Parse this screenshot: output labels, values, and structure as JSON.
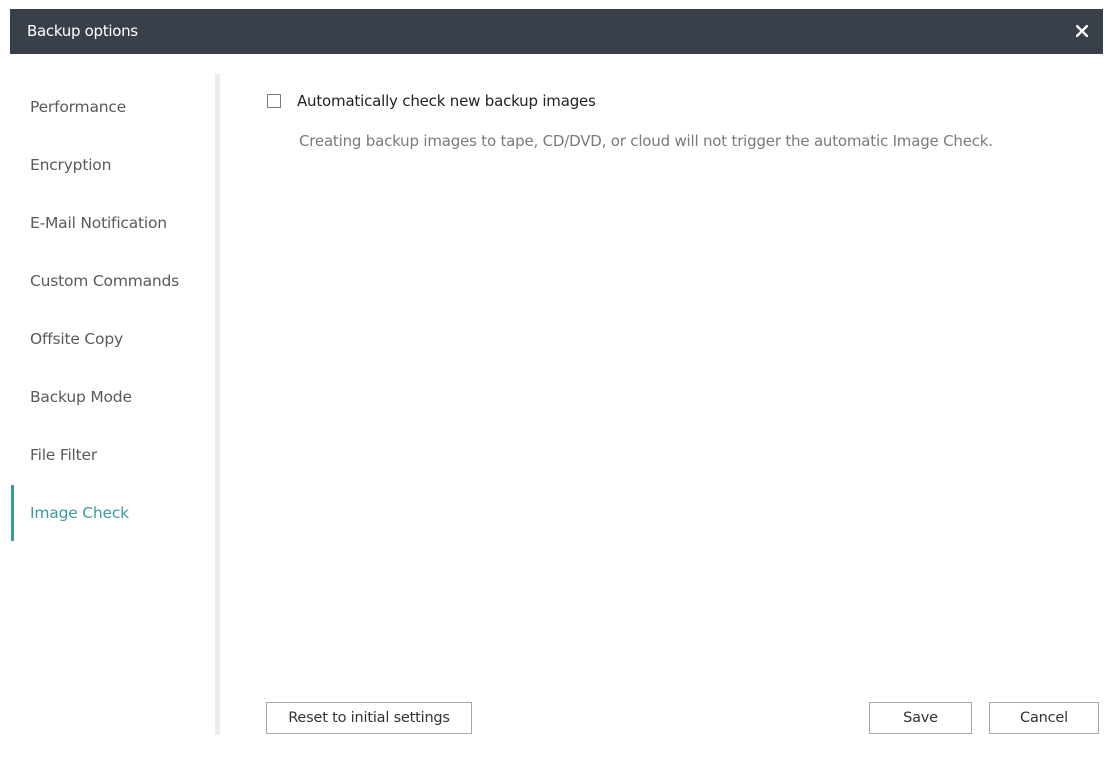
{
  "window": {
    "title": "Backup options",
    "close_icon": "close-icon",
    "colors": {
      "titlebar": "#394049",
      "accent": "#3d9a9c",
      "divider": "#ececec"
    }
  },
  "sidebar": {
    "items": [
      {
        "label": "Performance",
        "active": false
      },
      {
        "label": "Encryption",
        "active": false
      },
      {
        "label": "E-Mail Notification",
        "active": false
      },
      {
        "label": "Custom Commands",
        "active": false
      },
      {
        "label": "Offsite Copy",
        "active": false
      },
      {
        "label": "Backup Mode",
        "active": false
      },
      {
        "label": "File Filter",
        "active": false
      },
      {
        "label": "Image Check",
        "active": true
      }
    ]
  },
  "main": {
    "auto_check": {
      "label": "Automatically check new backup images",
      "checked": false
    },
    "description": "Creating backup images to tape, CD/DVD, or cloud will not trigger the automatic Image Check."
  },
  "footer": {
    "reset_label": "Reset to initial settings",
    "save_label": "Save",
    "cancel_label": "Cancel"
  }
}
